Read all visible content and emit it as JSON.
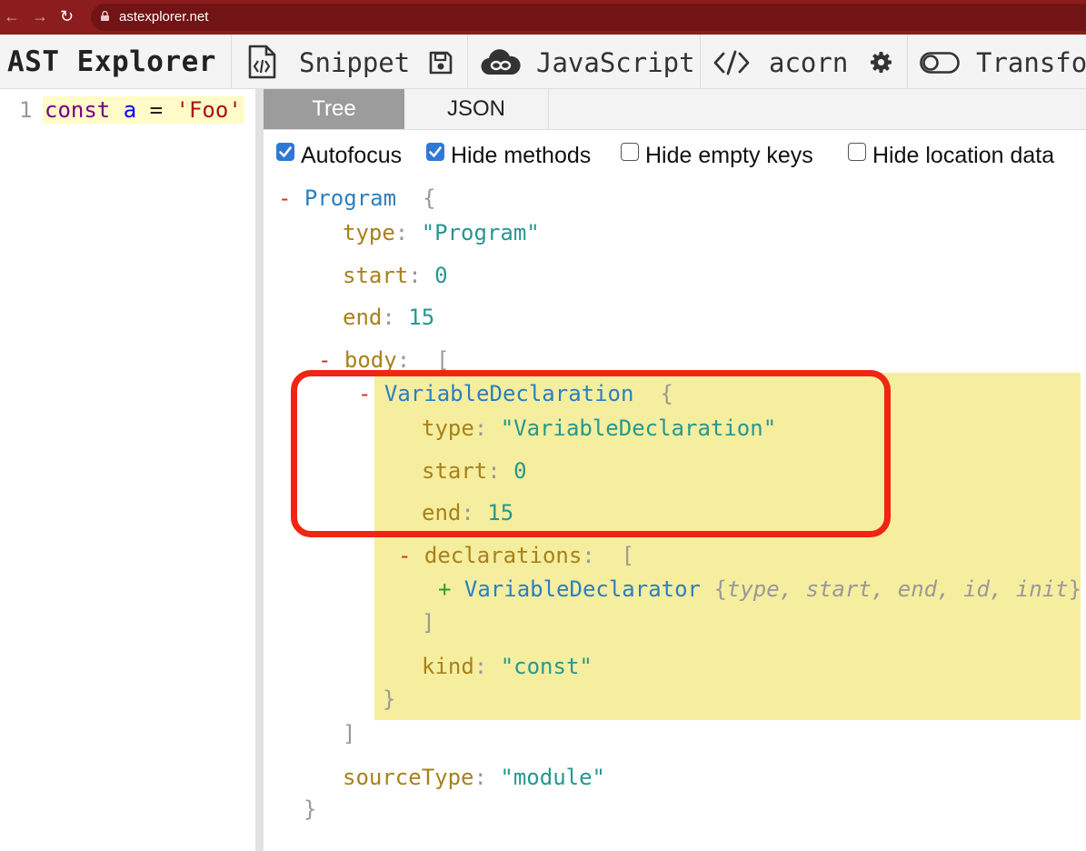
{
  "browser": {
    "url": "astexplorer.net"
  },
  "toolbar": {
    "title": "AST Explorer",
    "snippet_label": "Snippet",
    "language_label": "JavaScript",
    "parser_label": "acorn",
    "transform_label": "Transfo"
  },
  "editor": {
    "line_number": "1",
    "code": {
      "keyword": "const",
      "ident": "a",
      "op": "=",
      "string": "'Foo'"
    }
  },
  "tabs": {
    "tree": "Tree",
    "json": "JSON"
  },
  "options": [
    {
      "label": "Autofocus",
      "checked": true
    },
    {
      "label": "Hide methods",
      "checked": true
    },
    {
      "label": "Hide empty keys",
      "checked": false
    },
    {
      "label": "Hide location data",
      "checked": false
    }
  ],
  "tree": {
    "collapse_symbol": "-",
    "expand_symbol": "+",
    "open_brace": "{",
    "close_brace": "}",
    "open_bracket": "[",
    "close_bracket": "]",
    "colon": ":",
    "program": {
      "node": "Program",
      "type_key": "type",
      "type_val": "\"Program\"",
      "start_key": "start",
      "start_val": "0",
      "end_key": "end",
      "end_val": "15",
      "body_key": "body",
      "source_type_key": "sourceType",
      "source_type_val": "\"module\""
    },
    "var_decl": {
      "node": "VariableDeclaration",
      "type_key": "type",
      "type_val": "\"VariableDeclaration\"",
      "start_key": "start",
      "start_val": "0",
      "end_key": "end",
      "end_val": "15",
      "declarations_key": "declarations",
      "kind_key": "kind",
      "kind_val": "\"const\""
    },
    "declarator": {
      "node": "VariableDeclarator",
      "summary": "type, start, end, id, init"
    }
  },
  "colors": {
    "highlight": "#f6ee9f",
    "annotation_box": "#f02512",
    "browser_bar": "#8b1d1f"
  }
}
